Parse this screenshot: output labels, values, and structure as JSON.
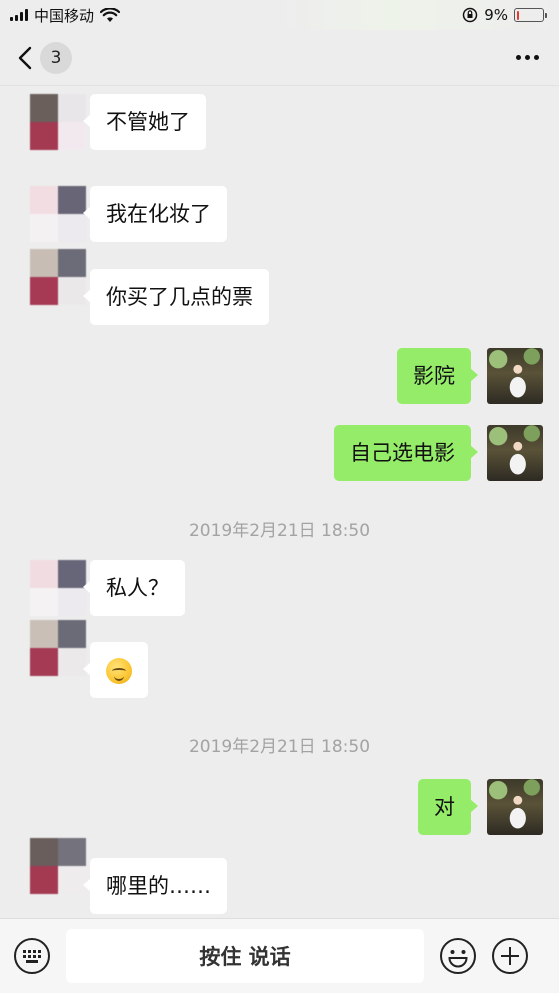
{
  "status_bar": {
    "carrier": "中国移动",
    "battery_percent": "9%",
    "battery_level": 0.09,
    "colors": {
      "battery_low": "#e53935"
    }
  },
  "nav": {
    "back_icon": "chevron-left-icon",
    "unread_count": "3",
    "more_icon": "more-dots-icon"
  },
  "messages": [
    {
      "side": "in",
      "type": "text",
      "text": "不管她了"
    },
    {
      "side": "in",
      "type": "text",
      "text": "我在化妆了"
    },
    {
      "side": "in",
      "type": "text",
      "text": "你买了几点的票"
    },
    {
      "side": "out",
      "type": "text",
      "text": "影院"
    },
    {
      "side": "out",
      "type": "text",
      "text": "自己选电影"
    },
    {
      "side": "in",
      "type": "text",
      "text": "私人？"
    },
    {
      "side": "in",
      "type": "emoji",
      "emoji": "smiling-face-emoji"
    },
    {
      "side": "out",
      "type": "text",
      "text": "对"
    },
    {
      "side": "in",
      "type": "text",
      "text": "哪里的……"
    }
  ],
  "timestamps": [
    "2019年2月21日 18:50",
    "2019年2月21日 18:50"
  ],
  "input_bar": {
    "keyboard_icon": "keyboard-icon",
    "hold_to_talk": "按住 说话",
    "emoji_icon": "smiley-icon",
    "plus_icon": "plus-circle-icon"
  },
  "colors": {
    "background": "#ededed",
    "bubble_out": "#95ec69",
    "bubble_in": "#ffffff",
    "timestamp": "#a3a3a3"
  }
}
